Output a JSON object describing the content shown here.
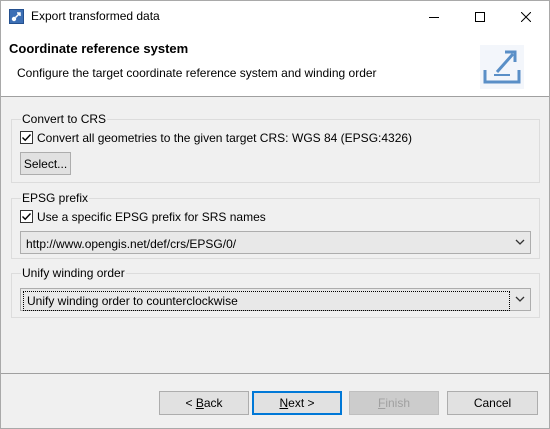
{
  "window": {
    "title": "Export transformed data",
    "controls": {
      "minimize": "minimize",
      "maximize": "maximize",
      "close": "close"
    }
  },
  "header": {
    "title": "Coordinate reference system",
    "description": "Configure the target coordinate reference system and winding order",
    "icon": "export-icon"
  },
  "crs_group": {
    "title": "Convert to CRS",
    "convert_checkbox_label": "Convert all geometries to the given target CRS:",
    "convert_checked": true,
    "crs_value": "WGS 84 (EPSG:4326)",
    "select_button": "Select..."
  },
  "epsg_group": {
    "title": "EPSG prefix",
    "prefix_checkbox_label": "Use a specific EPSG prefix for SRS names",
    "prefix_checked": true,
    "prefix_value": "http://www.opengis.net/def/crs/EPSG/0/"
  },
  "winding_group": {
    "title": "Unify winding order",
    "winding_value": "Unify winding order to counterclockwise"
  },
  "footer": {
    "back_label_prefix": "< ",
    "back_mnemonic": "B",
    "back_rest": "ack",
    "next_mnemonic": "N",
    "next_rest": "ext >",
    "finish_mnemonic": "F",
    "finish_rest": "inish",
    "cancel_label": "Cancel",
    "finish_enabled": false
  },
  "colors": {
    "default_button_border": "#0078d7",
    "header_background": "#ffffff",
    "dialog_background": "#f0f0f0"
  }
}
